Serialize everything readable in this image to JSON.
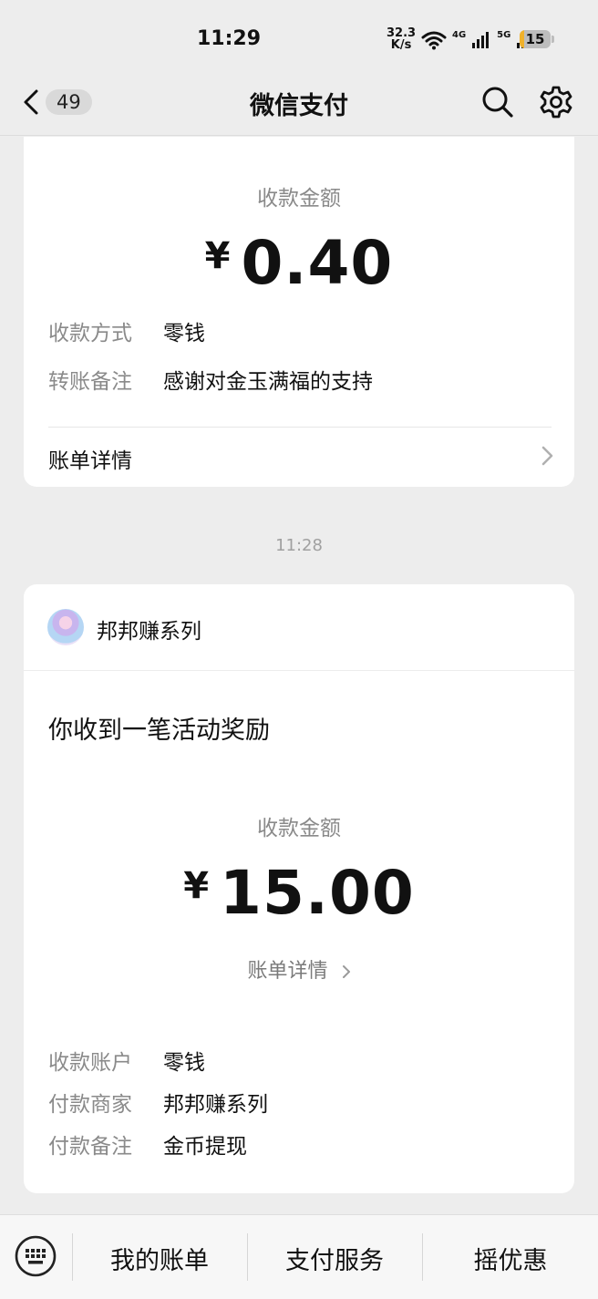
{
  "status_bar": {
    "time": "11:29",
    "speed_value": "32.3",
    "speed_unit": "K/s",
    "net1": "4G",
    "net2": "5G",
    "battery": "15",
    "battery_level": 0.15,
    "battery_color": "#f0b12a"
  },
  "nav": {
    "back_icon": "chevron-left-icon",
    "unread_count": "49",
    "title": "微信支付",
    "search_icon": "search-icon",
    "settings_icon": "gear-icon"
  },
  "card1": {
    "amount_label": "收款金额",
    "currency": "¥",
    "amount": "0.40",
    "rows": [
      {
        "key": "收款方式",
        "value": "零钱"
      },
      {
        "key": "转账备注",
        "value": "感谢对金玉满福的支持"
      }
    ],
    "detail_link": "账单详情"
  },
  "timestamp": "11:28",
  "card2": {
    "merchant": "邦邦赚系列",
    "headline": "你收到一笔活动奖励",
    "amount_label": "收款金额",
    "currency": "¥",
    "amount": "15.00",
    "detail_link": "账单详情",
    "rows": [
      {
        "key": "收款账户",
        "value": "零钱"
      },
      {
        "key": "付款商家",
        "value": "邦邦赚系列"
      },
      {
        "key": "付款备注",
        "value": "金币提现"
      }
    ]
  },
  "toolbar": {
    "keyboard_icon": "keyboard-icon",
    "items": [
      "我的账单",
      "支付服务",
      "摇优惠"
    ]
  }
}
